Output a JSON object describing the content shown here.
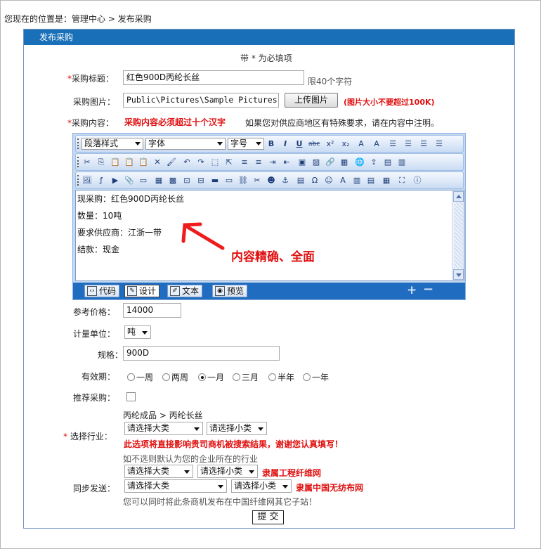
{
  "breadcrumb": {
    "prefix": "您现在的位置是：",
    "home": "管理中心",
    "sep": ">",
    "current": "发布采购"
  },
  "panel": {
    "title": "发布采购",
    "required_note": "带 * 为必填项"
  },
  "form": {
    "title": {
      "label": "采购标题：",
      "value": "红色900D丙纶长丝",
      "hint": "限40个字符"
    },
    "image": {
      "label": "采购图片：",
      "value": "Public\\Pictures\\Sample Pictures",
      "upload_button": "上传图片",
      "warning": "(图片大小不要超过100K)"
    },
    "content": {
      "label": "采购内容：",
      "warning": "采购内容必须超过十个汉字",
      "hint": "如果您对供应商地区有特殊要求，请在内容中注明。"
    },
    "price": {
      "label": "参考价格：",
      "value": "14000"
    },
    "unit": {
      "label": "计量单位：",
      "value": "吨"
    },
    "spec": {
      "label": "规格：",
      "value": "900D"
    },
    "validity": {
      "label": "有效期：",
      "options": [
        "一周",
        "两周",
        "一月",
        "三月",
        "半年",
        "一年"
      ],
      "selected": "一月"
    },
    "recommend": {
      "label": "推荐采购：",
      "checked": false
    },
    "industry": {
      "label": "选择行业：",
      "path": "丙纶成品 > 丙纶长丝",
      "major": "请选择大类",
      "minor": "请选择小类",
      "warning": "此选项将直接影响贵司商机被搜索结果，谢谢您认真填写！",
      "default_note": "如不选则默认为您的企业所在的行业"
    },
    "sync": {
      "label": "同步发送：",
      "rows": [
        {
          "major": "请选择大类",
          "minor": "请选择小类",
          "site": "隶属工程纤维网"
        },
        {
          "major": "请选择大类",
          "minor": "请选择小类",
          "site": "隶属中国无纺布网"
        }
      ],
      "note": "您可以同时将此条商机发布在中国纤维网其它子站！"
    },
    "submit": "提 交"
  },
  "editor": {
    "paragraph_style": "段落样式",
    "font": "字体",
    "font_size": "字号",
    "lines": [
      "现采购：红色900D丙纶长丝",
      "数量：10吨",
      "要求供应商：江浙一带",
      "结款：现金"
    ],
    "modes": [
      "代码",
      "设计",
      "文本",
      "预览"
    ],
    "active_mode": "设计"
  },
  "annotation": {
    "text": "内容精确、全面"
  },
  "colors": {
    "header_blue": "#1a70b8",
    "warning_red": "#e01010",
    "editor_bg": "#c5d9f1"
  }
}
